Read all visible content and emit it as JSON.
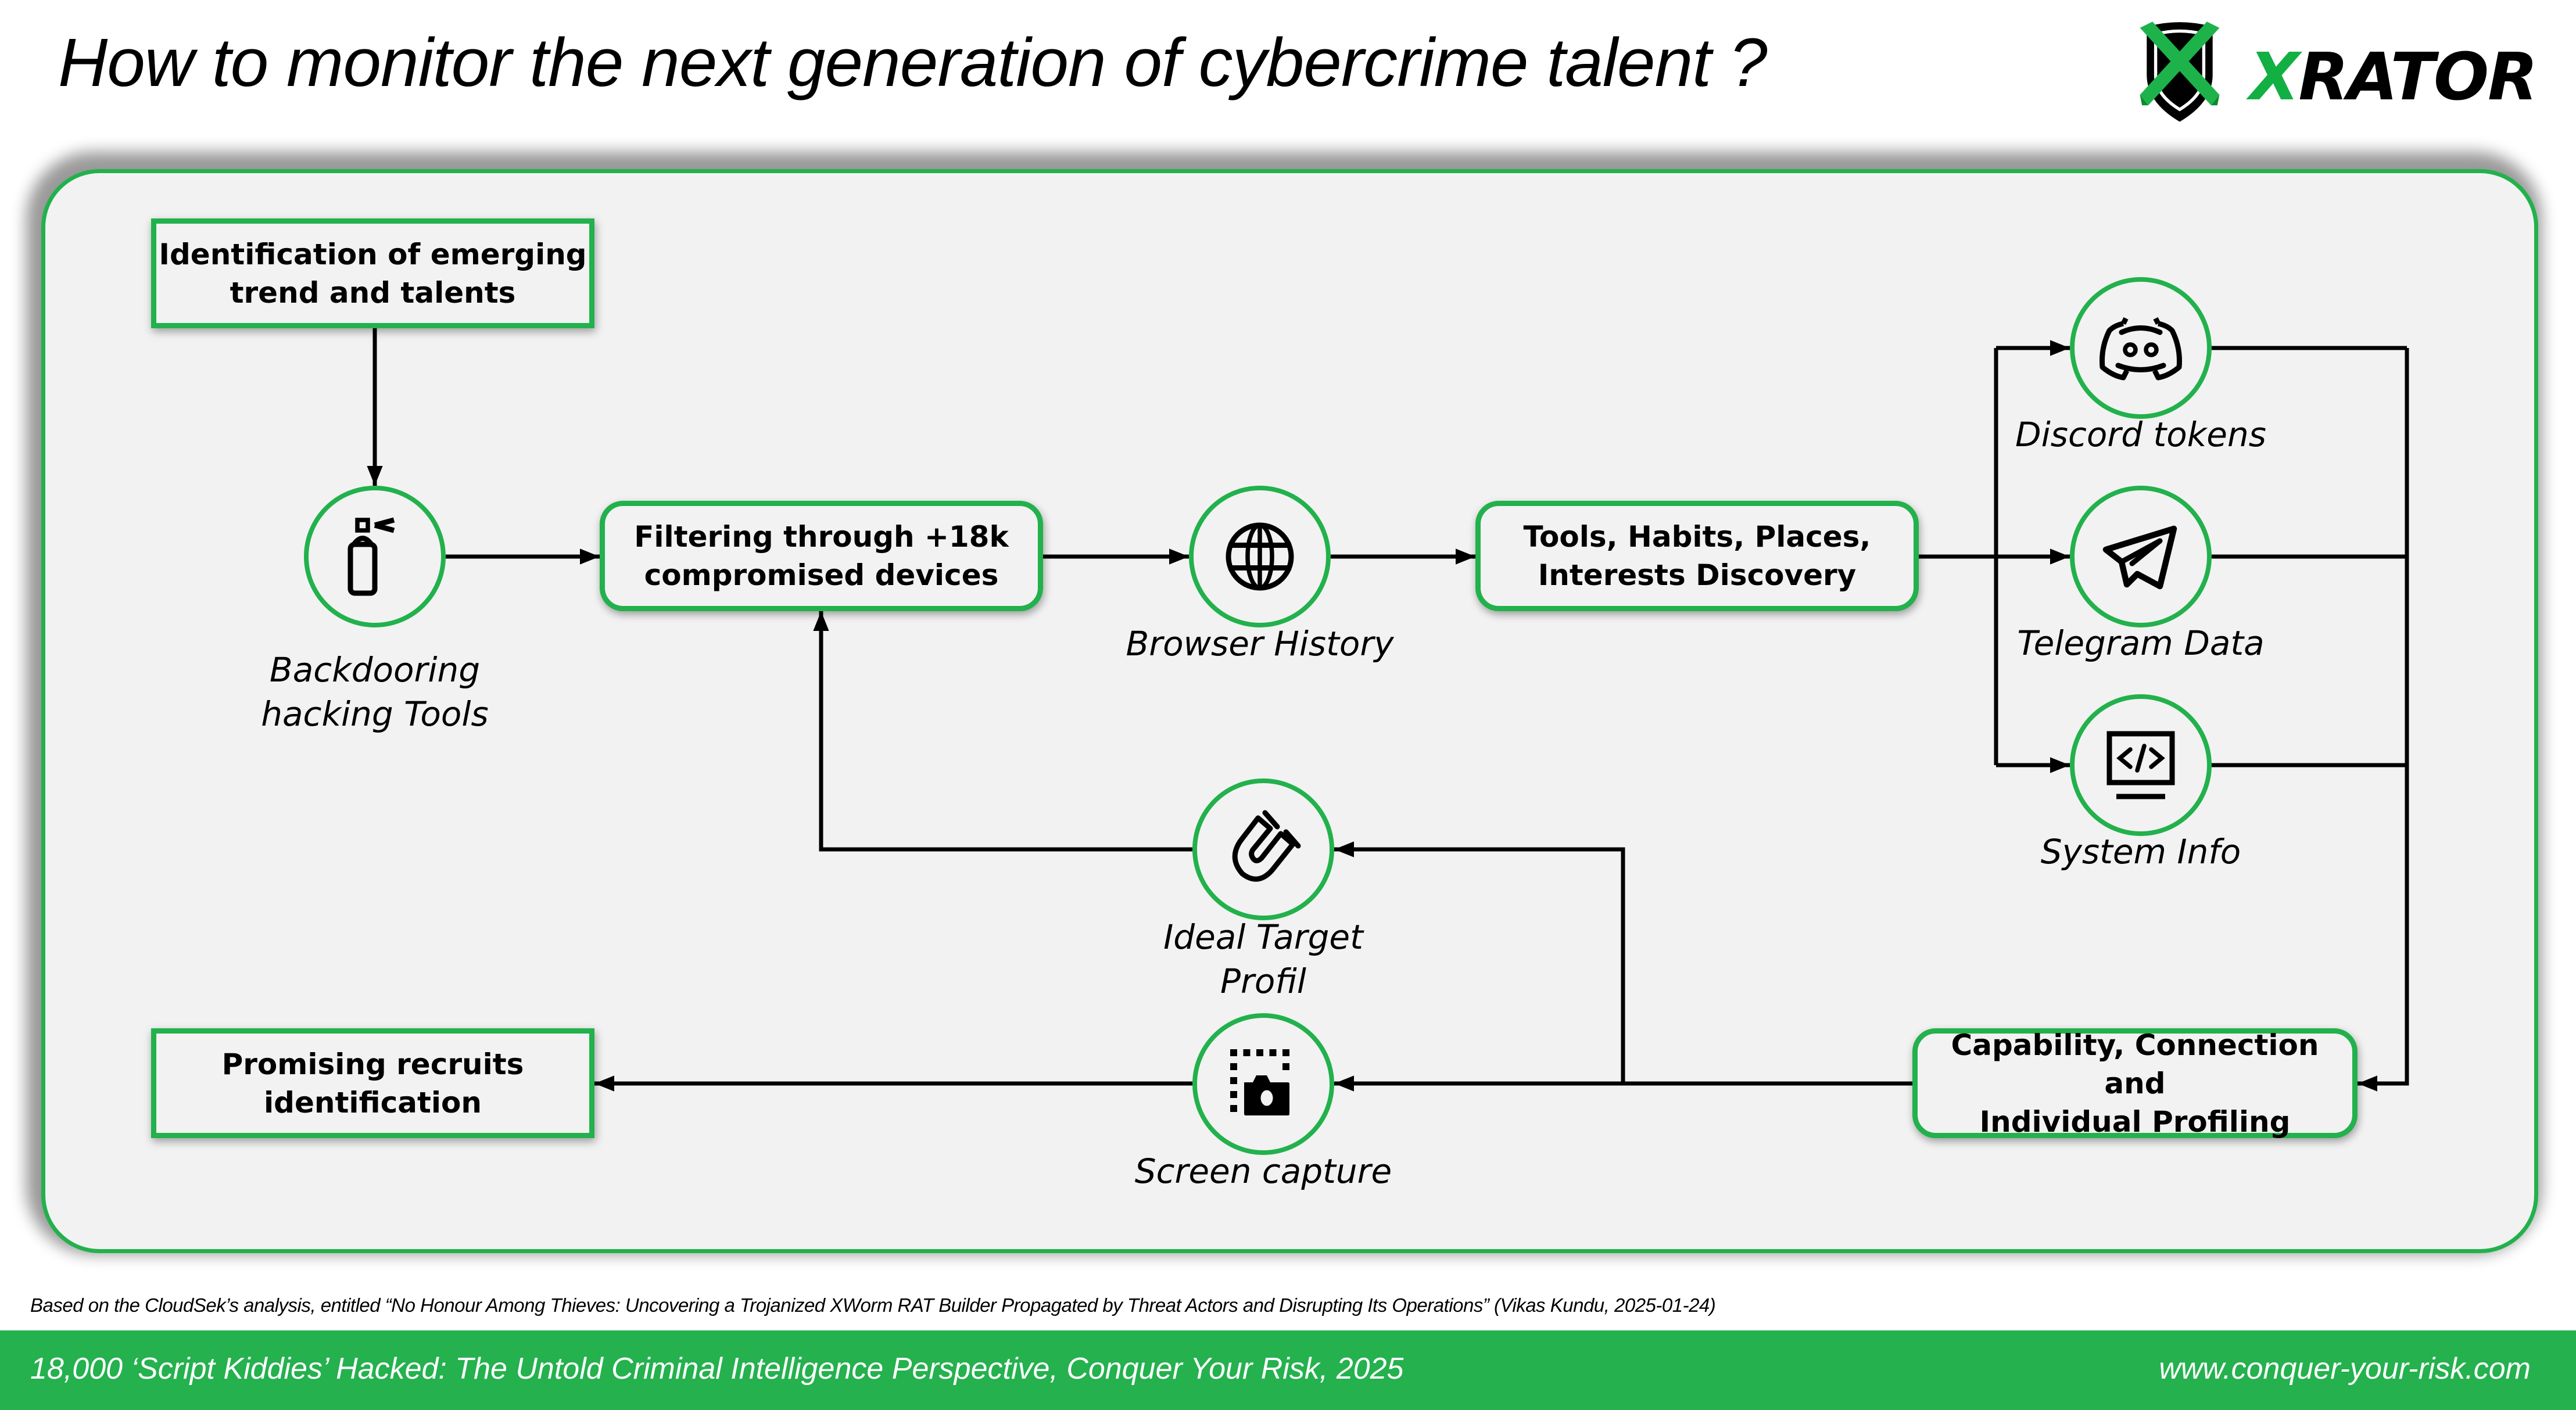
{
  "header": {
    "title": "How to monitor the next generation of cybercrime talent ?",
    "logo": {
      "mark_letter": "X",
      "rest": "RATOR",
      "brand_color": "#12b043",
      "icon": "shield-x-icon"
    }
  },
  "diagram": {
    "accent_color": "#22b14c",
    "boxes": {
      "identification": "Identification of emerging\ntrend and talents",
      "filtering": "Filtering through +18k\ncompromised devices",
      "tools": "Tools, Habits, Places,\nInterests Discovery",
      "capability": "Capability, Connection and\nIndividual Profiling",
      "promising": "Promising recruits\nidentification"
    },
    "nodes": {
      "backdooring": {
        "label": "Backdooring\nhacking Tools",
        "icon": "spray-can-icon"
      },
      "browser": {
        "label": "Browser History",
        "icon": "globe-icon"
      },
      "discord": {
        "label": "Discord tokens",
        "icon": "discord-icon"
      },
      "telegram": {
        "label": "Telegram Data",
        "icon": "telegram-icon"
      },
      "system": {
        "label": "System Info",
        "icon": "code-monitor-icon"
      },
      "ideal": {
        "label": "Ideal Target Profil",
        "icon": "magnet-icon"
      },
      "screen": {
        "label": "Screen capture",
        "icon": "screen-capture-icon"
      }
    }
  },
  "citation": "Based on the CloudSek’s analysis, entitled “No Honour Among Thieves: Uncovering a Trojanized XWorm RAT Builder Propagated by Threat Actors and Disrupting Its Operations” (Vikas Kundu, 2025-01-24)",
  "footer": {
    "left": "18,000 ‘Script Kiddies’ Hacked: The Untold Criminal Intelligence Perspective, Conquer Your Risk, 2025",
    "right": "www.conquer-your-risk.com",
    "color": "#24b14e"
  }
}
